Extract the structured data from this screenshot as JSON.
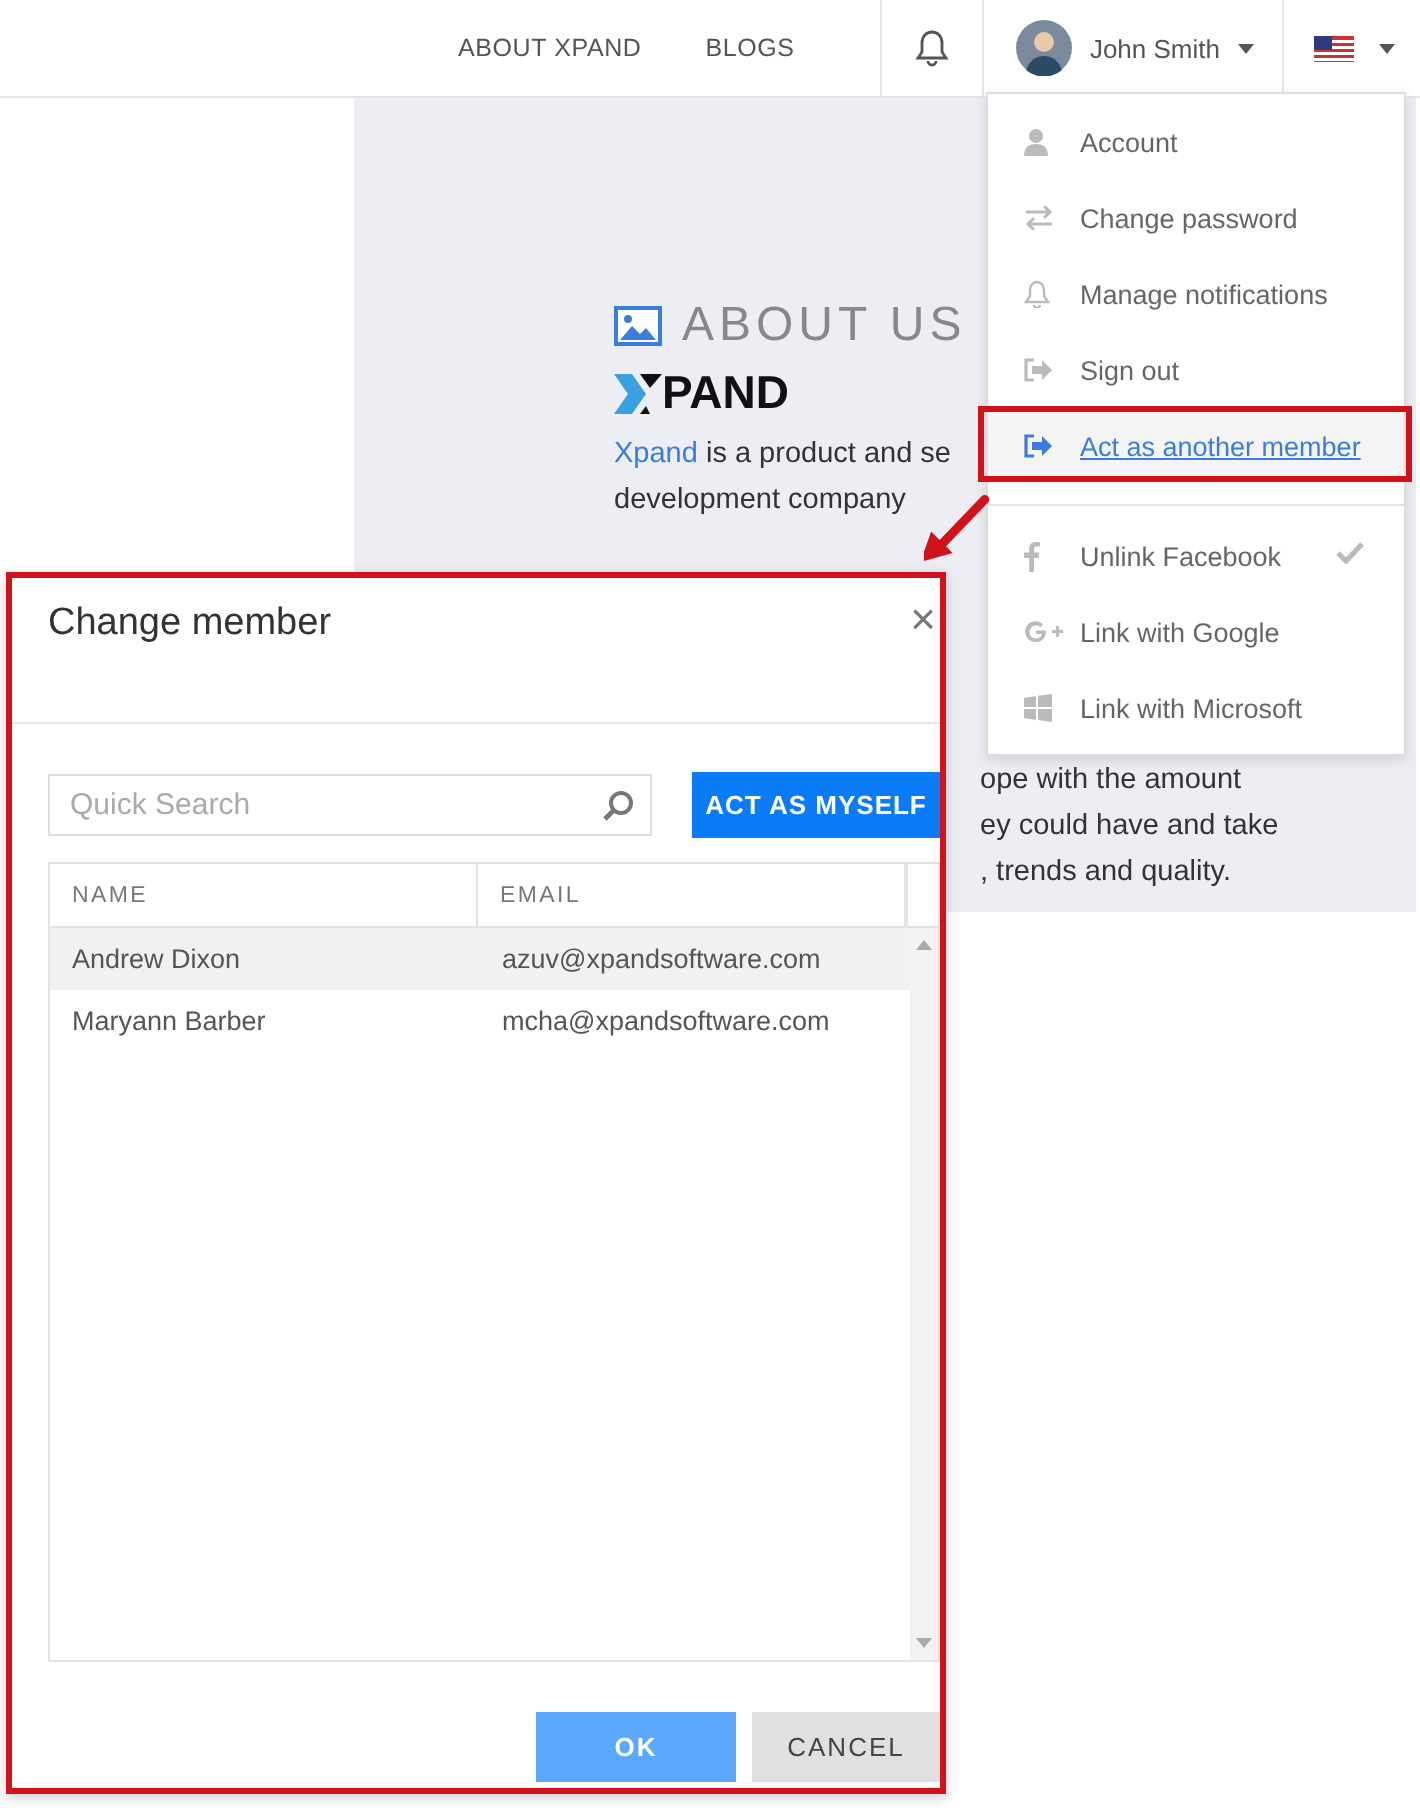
{
  "nav": {
    "links": [
      "ABOUT XPAND",
      "BLOGS"
    ],
    "user": "John Smith"
  },
  "about": {
    "title": "ABOUT US",
    "logo": "PAND",
    "link": "Xpand",
    "lines": [
      "is a product and se",
      "development company"
    ],
    "right_lines": [
      "ope with the amount",
      "ey could have and take",
      ", trends and quality."
    ]
  },
  "menu": {
    "items": [
      {
        "kind": "account",
        "label": "Account",
        "selected": false,
        "checked": false
      },
      {
        "kind": "password",
        "label": "Change password",
        "selected": false,
        "checked": false
      },
      {
        "kind": "notifications",
        "label": "Manage notifications",
        "selected": false,
        "checked": false
      },
      {
        "kind": "signout",
        "label": "Sign out",
        "selected": false,
        "checked": false
      },
      {
        "kind": "act",
        "label": "Act as another member",
        "selected": true,
        "checked": false
      },
      {
        "kind": "facebook",
        "label": "Unlink Facebook",
        "selected": false,
        "checked": true
      },
      {
        "kind": "google",
        "label": "Link with Google",
        "selected": false,
        "checked": false
      },
      {
        "kind": "microsoft",
        "label": "Link with Microsoft",
        "selected": false,
        "checked": false
      }
    ]
  },
  "dialog": {
    "title": "Change member",
    "close": "×",
    "search": {
      "placeholder": "Quick Search"
    },
    "act_button": "ACT AS MYSELF",
    "table": {
      "columns": [
        "NAME",
        "EMAIL"
      ],
      "rows": [
        {
          "name": "Andrew Dixon",
          "email": "azuv@xpandsoftware.com",
          "selected": true
        },
        {
          "name": "Maryann Barber",
          "email": "mcha@xpandsoftware.com",
          "selected": false
        }
      ]
    },
    "buttons": [
      "OK",
      "CANCEL"
    ]
  }
}
